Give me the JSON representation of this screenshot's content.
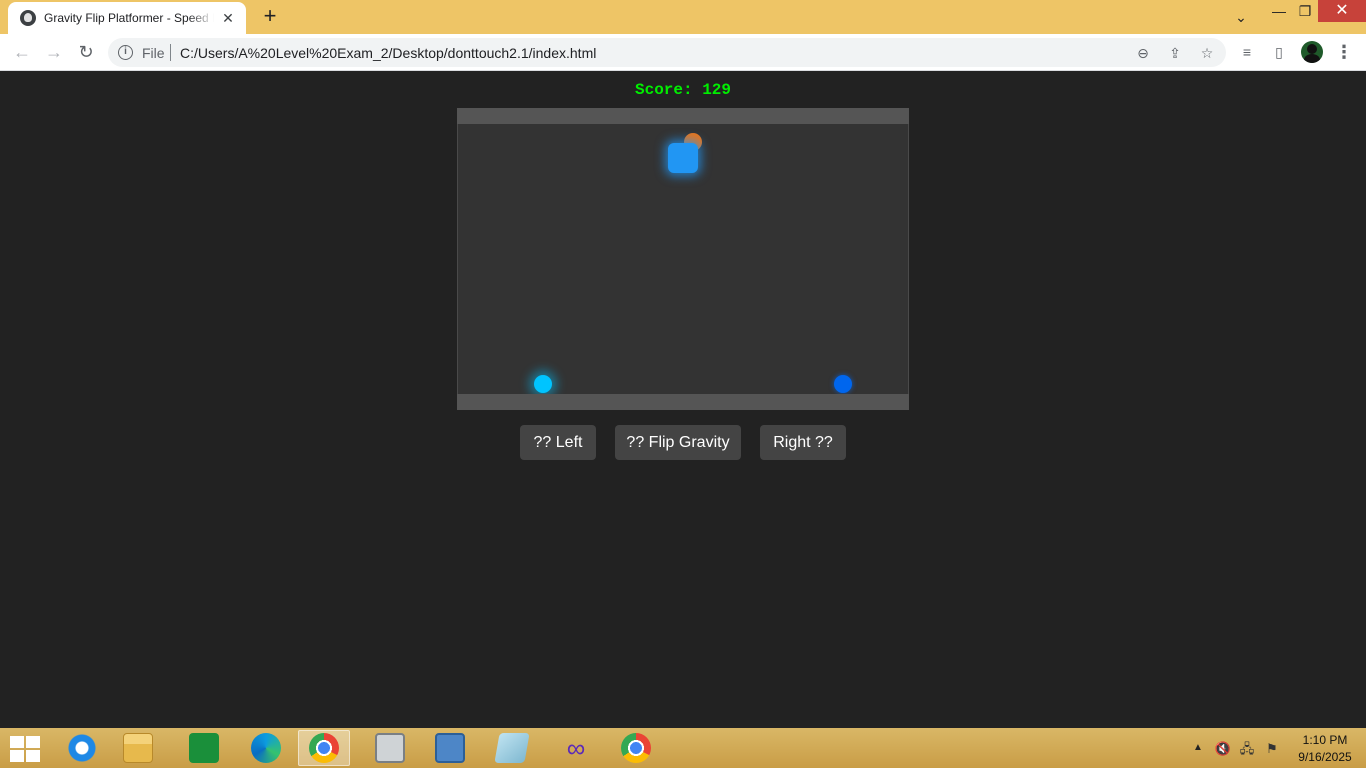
{
  "browser": {
    "tab_title": "Gravity Flip Platformer - Speed Platformer",
    "tab_close": "✕",
    "new_tab": "+",
    "scheme": "File",
    "url": "C:/Users/A%20Level%20Exam_2/Desktop/donttouch2.1/index.html",
    "window_controls": {
      "dropdown": "⌄",
      "minimize": "—",
      "maximize": "❐",
      "close": "✕"
    },
    "icons": {
      "back": "←",
      "forward": "→",
      "reload": "↻",
      "info": "i",
      "zoom": "⊖",
      "share": "⇪",
      "star": "☆",
      "media": "≡",
      "sidepanel": "▯",
      "menu": "⋮"
    }
  },
  "game": {
    "score_text": "Score: 129",
    "buttons": {
      "left": "?? Left",
      "flip": "?? Flip Gravity",
      "right": "Right ??"
    },
    "colors": {
      "player": "#2196f3",
      "orb_orange": "#e8741a",
      "orb_cyan": "#00c4ff",
      "orb_blue": "#0066ee",
      "score": "#00ee00",
      "background": "#222222"
    }
  },
  "taskbar": {
    "apps": [
      {
        "name": "internet-explorer",
        "active": false
      },
      {
        "name": "file-explorer",
        "active": false
      },
      {
        "name": "store",
        "active": false
      },
      {
        "name": "edge",
        "active": false
      },
      {
        "name": "chrome",
        "active": true
      },
      {
        "name": "disk-utility",
        "active": false
      },
      {
        "name": "control-panel",
        "active": false
      },
      {
        "name": "notepad",
        "active": false
      },
      {
        "name": "infinity-app",
        "active": false
      },
      {
        "name": "chrome",
        "active": false
      }
    ],
    "tray": {
      "chevron": "▲",
      "volume": "🔇",
      "network": "🖧",
      "flag": "⚑"
    },
    "time": "1:10 PM",
    "date": "9/16/2025"
  }
}
